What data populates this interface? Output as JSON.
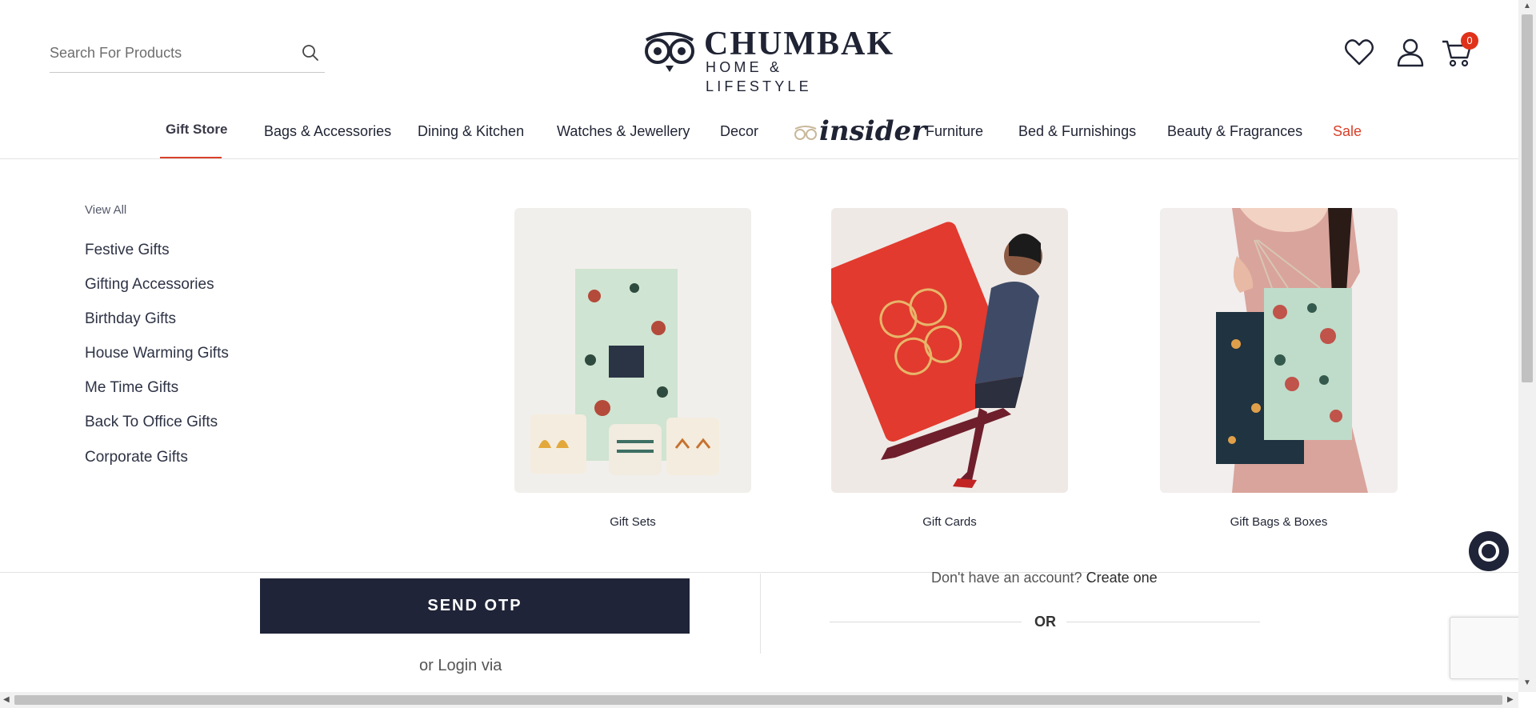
{
  "search": {
    "placeholder": "Search For Products"
  },
  "logo": {
    "name": "CHUMBAK",
    "tagline": "HOME & LIFESTYLE"
  },
  "header": {
    "cart_count": "0"
  },
  "nav": {
    "items": [
      {
        "label": "Gift Store"
      },
      {
        "label": "Bags & Accessories"
      },
      {
        "label": "Dining & Kitchen"
      },
      {
        "label": "Watches & Jewellery"
      },
      {
        "label": "Decor"
      },
      {
        "label": "insider"
      },
      {
        "label": "Furniture"
      },
      {
        "label": "Bed & Furnishings"
      },
      {
        "label": "Beauty & Fragrances"
      },
      {
        "label": "Sale"
      }
    ]
  },
  "dropdown": {
    "view_all": "View All",
    "links": [
      {
        "label": "Festive Gifts"
      },
      {
        "label": "Gifting Accessories"
      },
      {
        "label": "Birthday Gifts"
      },
      {
        "label": "House Warming Gifts"
      },
      {
        "label": "Me Time Gifts"
      },
      {
        "label": "Back To Office Gifts"
      },
      {
        "label": "Corporate Gifts"
      }
    ],
    "cards": [
      {
        "label": "Gift Sets"
      },
      {
        "label": "Gift Cards"
      },
      {
        "label": "Gift Bags & Boxes"
      }
    ]
  },
  "login": {
    "send_otp": "SEND OTP",
    "or_login_via": "or Login via",
    "no_account": "Don't have an account?",
    "create_one": "Create one",
    "or": "OR"
  },
  "colors": {
    "accent": "#d9402a",
    "navy": "#1f2438"
  }
}
